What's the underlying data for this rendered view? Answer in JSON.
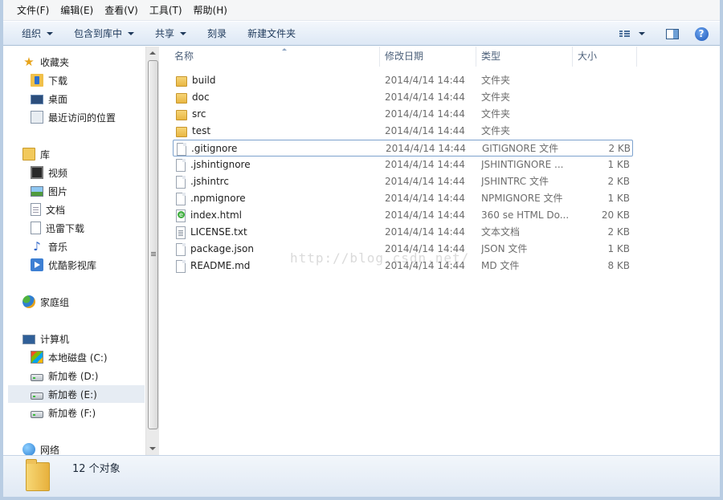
{
  "menu": [
    "文件(F)",
    "编辑(E)",
    "查看(V)",
    "工具(T)",
    "帮助(H)"
  ],
  "toolbar": {
    "organize": "组织",
    "include_in_library": "包含到库中",
    "share": "共享",
    "burn": "刻录",
    "new_folder": "新建文件夹"
  },
  "nav": {
    "favorites": "收藏夹",
    "downloads": "下载",
    "desktop": "桌面",
    "recent": "最近访问的位置",
    "libraries": "库",
    "videos": "视频",
    "pictures": "图片",
    "documents": "文档",
    "thunder": "迅雷下载",
    "music": "音乐",
    "youku": "优酷影视库",
    "homegroup": "家庭组",
    "computer": "计算机",
    "drive_c": "本地磁盘 (C:)",
    "drive_d": "新加卷 (D:)",
    "drive_e": "新加卷 (E:)",
    "drive_f": "新加卷 (F:)",
    "network": "网络"
  },
  "columns": {
    "name": "名称",
    "date": "修改日期",
    "type": "类型",
    "size": "大小"
  },
  "files": [
    {
      "name": "build",
      "date": "2014/4/14 14:44",
      "type": "文件夹",
      "size": "",
      "icon": "folder"
    },
    {
      "name": "doc",
      "date": "2014/4/14 14:44",
      "type": "文件夹",
      "size": "",
      "icon": "folder"
    },
    {
      "name": "src",
      "date": "2014/4/14 14:44",
      "type": "文件夹",
      "size": "",
      "icon": "folder"
    },
    {
      "name": "test",
      "date": "2014/4/14 14:44",
      "type": "文件夹",
      "size": "",
      "icon": "folder"
    },
    {
      "name": ".gitignore",
      "date": "2014/4/14 14:44",
      "type": "GITIGNORE 文件",
      "size": "2 KB",
      "icon": "file"
    },
    {
      "name": ".jshintignore",
      "date": "2014/4/14 14:44",
      "type": "JSHINTIGNORE ...",
      "size": "1 KB",
      "icon": "file"
    },
    {
      "name": ".jshintrc",
      "date": "2014/4/14 14:44",
      "type": "JSHINTRC 文件",
      "size": "2 KB",
      "icon": "file"
    },
    {
      "name": ".npmignore",
      "date": "2014/4/14 14:44",
      "type": "NPMIGNORE 文件",
      "size": "1 KB",
      "icon": "file"
    },
    {
      "name": "index.html",
      "date": "2014/4/14 14:44",
      "type": "360 se HTML Do...",
      "size": "20 KB",
      "icon": "html"
    },
    {
      "name": "LICENSE.txt",
      "date": "2014/4/14 14:44",
      "type": "文本文档",
      "size": "2 KB",
      "icon": "txt"
    },
    {
      "name": "package.json",
      "date": "2014/4/14 14:44",
      "type": "JSON 文件",
      "size": "1 KB",
      "icon": "file"
    },
    {
      "name": "README.md",
      "date": "2014/4/14 14:44",
      "type": "MD 文件",
      "size": "8 KB",
      "icon": "file"
    }
  ],
  "watermark": "http://blog.csdn.net/",
  "status": "12 个对象"
}
